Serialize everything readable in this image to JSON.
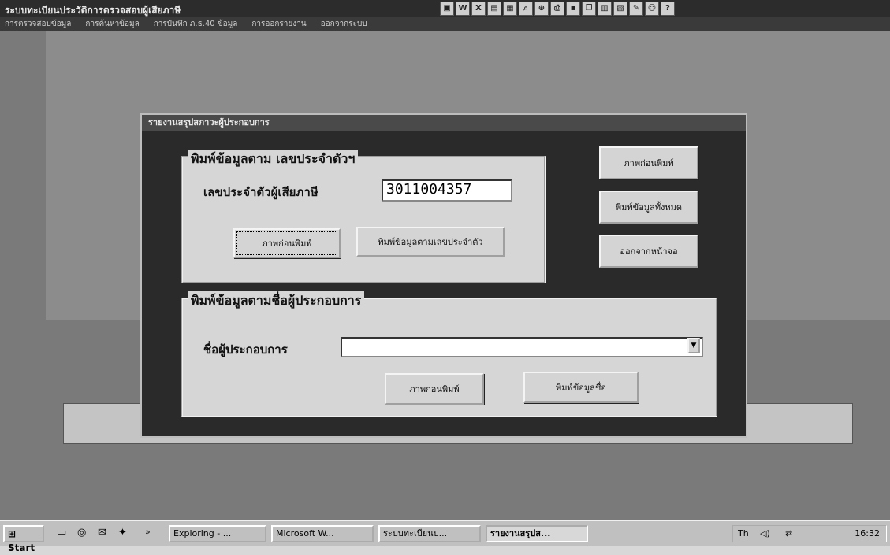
{
  "app": {
    "title": "ระบบทะเบียนประวัติการตรวจสอบผู้เสียภาษี"
  },
  "menu": [
    "การตรวจสอบข้อมูล",
    "การค้นหาข้อมูล",
    "การบันทึก ภ.ธ.40 ข้อมูล",
    "การออกรายงาน",
    "ออกจากระบบ"
  ],
  "dialog": {
    "title": "รายงานสรุปสภาวะผู้ประกอบการ",
    "group1": {
      "legend": "พิมพ์ข้อมูลตาม เลขประจำตัวฯ",
      "label": "เลขประจำตัวผู้เสียภาษี",
      "value": "3011004357",
      "preview_button": "ภาพก่อนพิมพ์",
      "print_button": "พิมพ์ข้อมูลตามเลขประจำตัว"
    },
    "side": {
      "preview_button": "ภาพก่อนพิมพ์",
      "print_all_button": "พิมพ์ข้อมูลทั้งหมด",
      "exit_button": "ออกจากหน้าจอ"
    },
    "group2": {
      "legend": "พิมพ์ข้อมูลตามชื่อผู้ประกอบการ",
      "label": "ชื่อผู้ประกอบการ",
      "value": "",
      "preview_button": "ภาพก่อนพิมพ์",
      "print_button": "พิมพ์ข้อมูลชื่อ"
    }
  },
  "taskbar": {
    "start_label": "Start",
    "tasks": [
      "Exploring - ...",
      "Microsoft W...",
      "ระบบทะเบียนป...",
      "รายงานสรุปส..."
    ],
    "active_task_index": 3,
    "tray_text": "Th",
    "clock": "16:32"
  },
  "icons": {
    "toolbar": [
      "print-preview-icon",
      "word-icon",
      "excel-icon",
      "form-icon",
      "report-icon",
      "search-icon",
      "zoom-icon",
      "print-icon",
      "save-icon",
      "copy-icon",
      "table-icon",
      "chart-icon",
      "tool-icon",
      "user-icon",
      "help-icon"
    ],
    "quick_launch": [
      "desktop-icon",
      "browser-icon",
      "mail-icon",
      "channel-icon"
    ]
  },
  "colors": {
    "titlebar": "#2c2c2c",
    "dialog_bg": "#2a2a2a",
    "groupbox": "#d6d6d6",
    "button": "#d4d4d4"
  }
}
